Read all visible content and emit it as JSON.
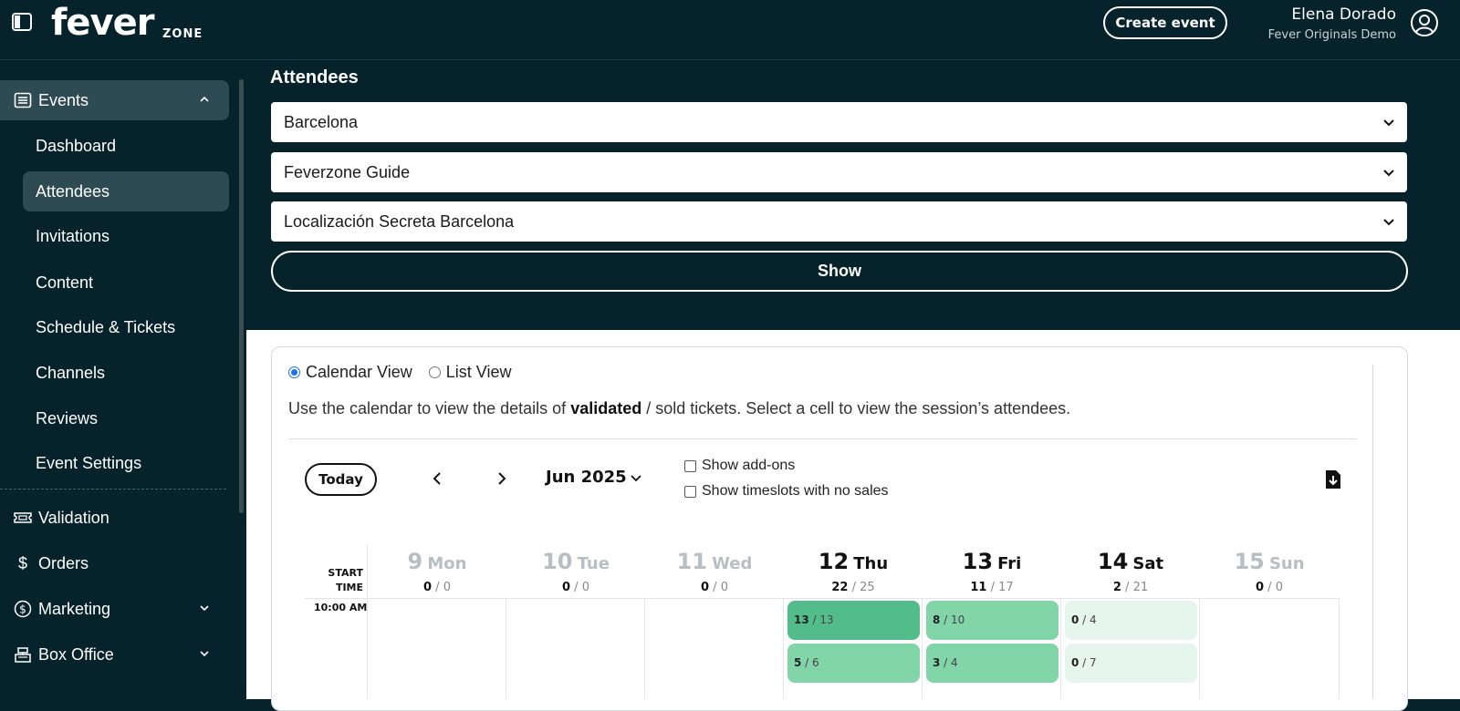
{
  "header": {
    "logo_text": "fever",
    "logo_sub": "ZONE",
    "create_event_label": "Create event",
    "user_name": "Elena Dorado",
    "user_org": "Fever Originals Demo"
  },
  "sidebar": {
    "events_label": "Events",
    "sub_items": [
      "Dashboard",
      "Attendees",
      "Invitations",
      "Content",
      "Schedule & Tickets",
      "Channels",
      "Reviews",
      "Event Settings"
    ],
    "validation_label": "Validation",
    "orders_label": "Orders",
    "marketing_label": "Marketing",
    "box_office_label": "Box Office"
  },
  "attendees": {
    "title": "Attendees",
    "city_select": "Barcelona",
    "program_select": "Feverzone Guide",
    "venue_select": "Localización Secreta Barcelona",
    "show_label": "Show"
  },
  "view": {
    "calendar_view_label": "Calendar View",
    "list_view_label": "List View",
    "selected": "Calendar View",
    "desc_prefix": "Use the calendar to view the details of ",
    "desc_bold": "validated",
    "desc_suffix": " / sold tickets. Select a cell to view the session’s attendees."
  },
  "calendar": {
    "today_label": "Today",
    "month_label": "Jun 2025",
    "show_addons_label": "Show add-ons",
    "show_timeslots_label": "Show timeslots with no sales",
    "start_time_line1": "START",
    "start_time_line2": "TIME",
    "time_label": "10:00 AM",
    "days": [
      {
        "num": "9",
        "wd": "Mon",
        "validated": "0",
        "sold": "0"
      },
      {
        "num": "10",
        "wd": "Tue",
        "validated": "0",
        "sold": "0"
      },
      {
        "num": "11",
        "wd": "Wed",
        "validated": "0",
        "sold": "0"
      },
      {
        "num": "12",
        "wd": "Thu",
        "validated": "22",
        "sold": "25"
      },
      {
        "num": "13",
        "wd": "Fri",
        "validated": "11",
        "sold": "17"
      },
      {
        "num": "14",
        "wd": "Sat",
        "validated": "2",
        "sold": "21"
      },
      {
        "num": "15",
        "wd": "Sun",
        "validated": "0",
        "sold": "0"
      }
    ],
    "slots": {
      "thu_1": {
        "validated": "13",
        "sold": "13",
        "color": "#52bd8a"
      },
      "thu_2": {
        "validated": "5",
        "sold": "6",
        "color": "#82d4a9"
      },
      "fri_1": {
        "validated": "8",
        "sold": "10",
        "color": "#82d4a9"
      },
      "fri_2": {
        "validated": "3",
        "sold": "4",
        "color": "#82d4a9"
      },
      "sat_1": {
        "validated": "0",
        "sold": "4",
        "color": "#e6f6ec"
      },
      "sat_2": {
        "validated": "0",
        "sold": "7",
        "color": "#e6f6ec"
      }
    }
  },
  "colors": {
    "dark_bg": "#06222b",
    "active_item": "#2e4a52",
    "accent_blue": "#1a73e8"
  }
}
